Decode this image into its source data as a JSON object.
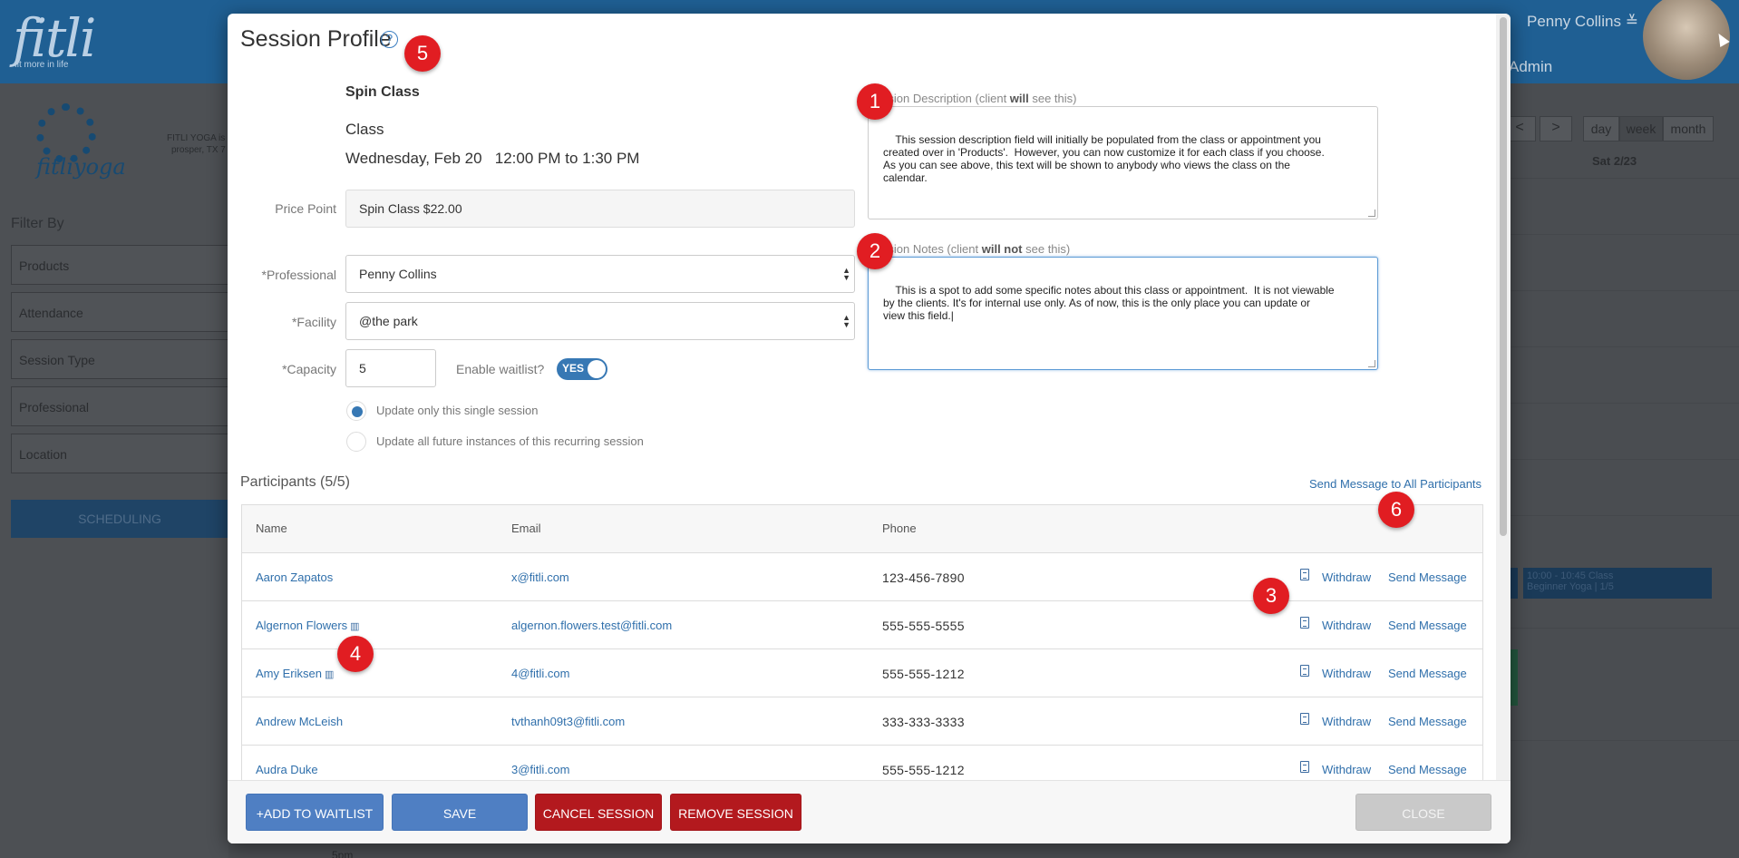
{
  "background": {
    "logo": "fitli",
    "logo_tagline": "fit more in life",
    "user_name": "Penny Collins",
    "user_role": "Admin",
    "studio_logo": "fitliyoga",
    "studio_address": "FITLI YOGA is f\nprosper, TX 7",
    "filter_title": "Filter By",
    "filters": [
      "Products",
      "Attendance",
      "Session Type",
      "Professional",
      "Location"
    ],
    "scheduling_label": "SCHEDULING",
    "nav_prev": "<",
    "nav_next": ">",
    "views": [
      "day",
      "week",
      "month"
    ],
    "date_header": "Sat 2/23",
    "event_text": "10:00 - 10:45 Class\nBeginner Yoga | 1/5",
    "bottom_time": "5pm"
  },
  "modal": {
    "title": "Session Profile",
    "help_icon": "?",
    "session": {
      "name": "Spin Class",
      "type": "Class",
      "date": "Wednesday, Feb 20",
      "time": "12:00 PM to 1:30 PM"
    },
    "fields": {
      "price_point_label": "Price Point",
      "price_point_value": "Spin Class $22.00",
      "professional_label": "*Professional",
      "professional_value": "Penny Collins",
      "facility_label": "*Facility",
      "facility_value": "@the park",
      "capacity_label": "*Capacity",
      "capacity_value": "5",
      "waitlist_label": "Enable waitlist?",
      "waitlist_toggle": "YES"
    },
    "update_options": {
      "single": "Update only this single session",
      "all": "Update all future instances of this recurring session",
      "selected": "single"
    },
    "description": {
      "label_pre": "Session Description (client ",
      "label_bold": "will",
      "label_post": " see this)",
      "text": "This session description field will initially be populated from the class or appointment you\ncreated over in 'Products'.  However, you can now customize it for each class if you choose.\nAs you can see above, this text will be shown to anybody who views the class on the\ncalendar."
    },
    "notes": {
      "label_pre": "Session Notes (client ",
      "label_bold": "will not",
      "label_post": " see this)",
      "text": "This is a spot to add some specific notes about this class or appointment.  It is not viewable\nby the clients. It's for internal use only. As of now, this is the only place you can update or\nview this field.|"
    },
    "participants": {
      "title": "Participants (5/5)",
      "send_all": "Send Message to All Participants",
      "columns": [
        "Name",
        "Email",
        "Phone"
      ],
      "rows": [
        {
          "name": "Aaron Zapatos",
          "waitlist": false,
          "email": "x@fitli.com",
          "phone": "123-456-7890"
        },
        {
          "name": "Algernon Flowers",
          "waitlist": true,
          "email": "algernon.flowers.test@fitli.com",
          "phone": "555-555-5555"
        },
        {
          "name": "Amy Eriksen",
          "waitlist": true,
          "email": "4@fitli.com",
          "phone": "555-555-1212"
        },
        {
          "name": "Andrew McLeish",
          "waitlist": false,
          "email": "tvthanh09t3@fitli.com",
          "phone": "333-333-3333"
        },
        {
          "name": "Audra Duke",
          "waitlist": false,
          "email": "3@fitli.com",
          "phone": "555-555-1212"
        }
      ],
      "withdraw_label": "Withdraw",
      "send_message_label": "Send Message"
    },
    "footer": {
      "add_waitlist": "+ADD TO WAITLIST",
      "save": "SAVE",
      "cancel_session": "CANCEL SESSION",
      "remove_session": "REMOVE SESSION",
      "close": "CLOSE"
    },
    "badges": [
      "1",
      "2",
      "3",
      "4",
      "5",
      "6"
    ]
  },
  "colors": {
    "accent_blue": "#3778b4",
    "link_blue": "#2f6fab",
    "danger_red": "#b3191e",
    "badge_red": "#e11d22"
  }
}
